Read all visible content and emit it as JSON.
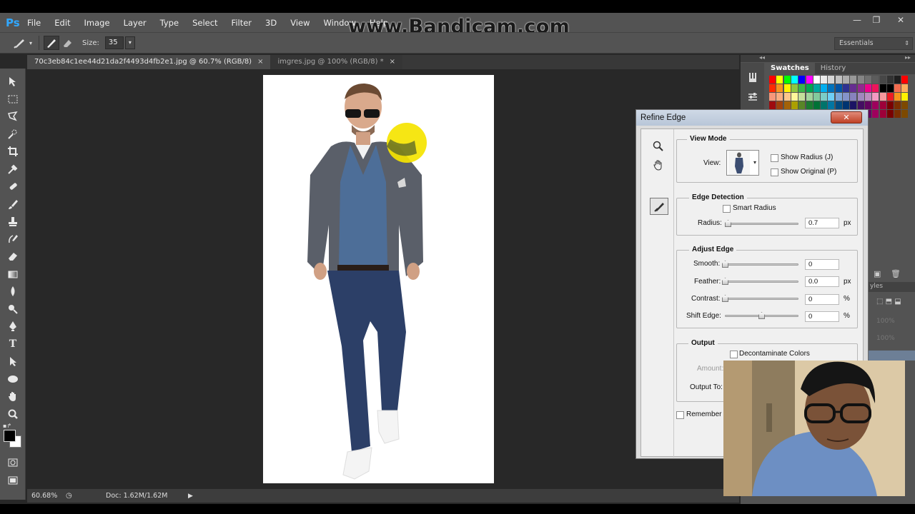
{
  "app": {
    "logo": "Ps",
    "menus": [
      "File",
      "Edit",
      "Image",
      "Layer",
      "Type",
      "Select",
      "Filter",
      "3D",
      "View",
      "Window",
      "Help"
    ],
    "watermark": "www.Bandicam.com",
    "window_controls": [
      "—",
      "❐",
      "✕"
    ]
  },
  "options_bar": {
    "size_label": "Size:",
    "size_value": "35",
    "workspace": "Essentials"
  },
  "tabs": [
    {
      "label": "70c3eb84c1ee44d21da2f4493d4fb2e1.jpg @ 60.7% (RGB/8)",
      "close": "×",
      "active": true
    },
    {
      "label": "imgres.jpg @ 100% (RGB/8) *",
      "close": "×",
      "active": false
    }
  ],
  "status": {
    "zoom": "60.68%",
    "doc": "Doc: 1.62M/1.62M"
  },
  "panels": {
    "swatches_tab": "Swatches",
    "history_tab": "History",
    "styles_fragment": "yles",
    "opacity_ghost": "100%",
    "fill_ghost": "100%"
  },
  "refine_edge": {
    "title": "Refine Edge",
    "close": "✕",
    "view_mode": {
      "heading": "View Mode",
      "view_label": "View:",
      "show_radius": "Show Radius (J)",
      "show_original": "Show Original (P)"
    },
    "edge_detection": {
      "heading": "Edge Detection",
      "smart_radius": "Smart Radius",
      "radius_label": "Radius:",
      "radius_value": "0.7",
      "radius_unit": "px",
      "radius_level": 0.02
    },
    "adjust_edge": {
      "heading": "Adjust Edge",
      "smooth_label": "Smooth:",
      "smooth_value": "0",
      "feather_label": "Feather:",
      "feather_value": "0.0",
      "feather_unit": "px",
      "contrast_label": "Contrast:",
      "contrast_value": "0",
      "contrast_unit": "%",
      "shift_label": "Shift Edge:",
      "shift_value": "0",
      "shift_unit": "%"
    },
    "output": {
      "heading": "Output",
      "decontaminate": "Decontaminate Colors",
      "amount_label": "Amount:",
      "output_to_label": "Output To:"
    },
    "remember": "Remember S"
  },
  "colors": {
    "ps_blue": "#31a8ff",
    "brush_marker": "#f5e400",
    "swatch_row1": [
      "#ff0000",
      "#ffff00",
      "#00ff00",
      "#00ffff",
      "#0000ff",
      "#ff00ff",
      "#ffffff",
      "#ebebeb",
      "#d6d6d6",
      "#c2c2c2",
      "#adadad",
      "#999999",
      "#858585",
      "#707070",
      "#5c5c5c",
      "#474747",
      "#333333",
      "#1f1f1f",
      "#ff0000"
    ],
    "swatch_row2": [
      "#ff2a00",
      "#f7941d",
      "#fff200",
      "#8dc63f",
      "#39b54a",
      "#00a651",
      "#00a99d",
      "#00aeef",
      "#0072bc",
      "#0054a6",
      "#2e3192",
      "#662d91",
      "#92278f",
      "#ec008c",
      "#ed145b",
      "#000000",
      "#000000",
      "#f26c4f",
      "#fbaf5d"
    ]
  }
}
